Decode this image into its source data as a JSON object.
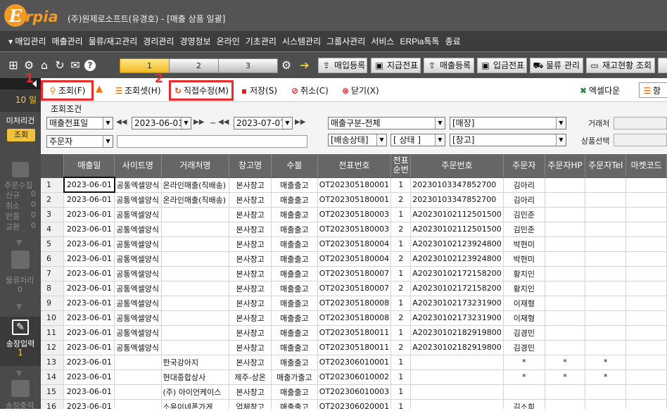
{
  "app": {
    "logo_initial": "E",
    "logo_rest": "rpia",
    "window_title": "(주)원제로소프트(유경호) - [매출 상품 일괄]"
  },
  "menu": [
    "▾ 매입관리",
    "매출관리",
    "물류/재고관리",
    "경리관리",
    "경영정보",
    "온라인",
    "기초관리",
    "시스템관리",
    "그룹사관리",
    "서비스",
    "ERPia톡톡",
    "종료"
  ],
  "tabs": [
    "1",
    "2",
    "3"
  ],
  "toolbar_buttons": [
    "매입등록",
    "지급전표",
    "매출등록",
    "입금전표",
    "물류 관리",
    "재고현황 조회"
  ],
  "left_panel": {
    "day": "10 일",
    "uncounted_label": "미처리건",
    "inquiry_btn": "조회",
    "order_collect": "주문수집",
    "new": "신규",
    "new_n": "0",
    "cancel": "취소",
    "cancel_n": "0",
    "return": "반품",
    "return_n": "0",
    "exchange": "교환",
    "exchange_n": "0",
    "logistics": "물류처리",
    "logistics_n": "0",
    "order_input": "송장입력",
    "order_input_n": "1",
    "ship_print": "송장출력"
  },
  "commands": {
    "search": "조회(F)",
    "search_set": "조회셋(H)",
    "direct_edit": "직접수정(M)",
    "save": "저장(S)",
    "cancel": "취소(C)",
    "close": "닫기(X)",
    "excel": "엑셀다운",
    "more": "항"
  },
  "annotations": {
    "label1": "1",
    "label2": "2"
  },
  "conditions": {
    "title": "조회조건",
    "date_type": "매출전표일",
    "date_from": "2023-06-01",
    "tilde": "~",
    "date_to": "2023-07-07",
    "sales_type": "매출구분-전체",
    "store": "[매장]",
    "customer_label": "거래처",
    "orderer": "주문자",
    "ship_status": "[배송상태]",
    "status": "[ 상태 ]",
    "warehouse": "[창고]",
    "product_label": "상품선택"
  },
  "grid": {
    "headers": [
      "매출일",
      "사이트명",
      "거래처명",
      "창고명",
      "수불",
      "전표번호",
      "전표\n순번",
      "주문번호",
      "주문자",
      "주문자HP",
      "주문자Tel",
      "마켓코드"
    ],
    "rows": [
      [
        "1",
        "2023-06-01",
        "공통엑셀양식",
        "온라인매출(직배송)",
        "본사창고",
        "매출출고",
        "OT202305180001",
        "1",
        "20230103347852700",
        "김아리",
        "",
        "",
        ""
      ],
      [
        "2",
        "2023-06-01",
        "공통엑셀양식",
        "온라인매출(직배송)",
        "본사창고",
        "매출출고",
        "OT202305180001",
        "2",
        "20230103347852700",
        "김아리",
        "",
        "",
        ""
      ],
      [
        "3",
        "2023-06-01",
        "공통엑셀양식",
        "",
        "본사창고",
        "매출출고",
        "OT202305180003",
        "1",
        "A20230102112501500",
        "김민준",
        "",
        "",
        ""
      ],
      [
        "4",
        "2023-06-01",
        "공통엑셀양식",
        "",
        "본사창고",
        "매출출고",
        "OT202305180003",
        "2",
        "A20230102112501500",
        "김민준",
        "",
        "",
        ""
      ],
      [
        "5",
        "2023-06-01",
        "공통엑셀양식",
        "",
        "본사창고",
        "매출출고",
        "OT202305180004",
        "1",
        "A20230102123924800",
        "박현미",
        "",
        "",
        ""
      ],
      [
        "6",
        "2023-06-01",
        "공통엑셀양식",
        "",
        "본사창고",
        "매출출고",
        "OT202305180004",
        "2",
        "A20230102123924800",
        "박현미",
        "",
        "",
        ""
      ],
      [
        "7",
        "2023-06-01",
        "공통엑셀양식",
        "",
        "본사창고",
        "매출출고",
        "OT202305180007",
        "1",
        "A20230102172158200",
        "황지인",
        "",
        "",
        ""
      ],
      [
        "8",
        "2023-06-01",
        "공통엑셀양식",
        "",
        "본사창고",
        "매출출고",
        "OT202305180007",
        "2",
        "A20230102172158200",
        "황지인",
        "",
        "",
        ""
      ],
      [
        "9",
        "2023-06-01",
        "공통엑셀양식",
        "",
        "본사창고",
        "매출출고",
        "OT202305180008",
        "1",
        "A20230102173231900",
        "이재형",
        "",
        "",
        ""
      ],
      [
        "10",
        "2023-06-01",
        "공통엑셀양식",
        "",
        "본사창고",
        "매출출고",
        "OT202305180008",
        "2",
        "A20230102173231900",
        "이재형",
        "",
        "",
        ""
      ],
      [
        "11",
        "2023-06-01",
        "공통엑셀양식",
        "",
        "본사창고",
        "매출출고",
        "OT202305180011",
        "1",
        "A20230102182919800",
        "김경민",
        "",
        "",
        ""
      ],
      [
        "12",
        "2023-06-01",
        "공통엑셀양식",
        "",
        "본사창고",
        "매출출고",
        "OT202305180011",
        "2",
        "A20230102182919800",
        "김경민",
        "",
        "",
        ""
      ],
      [
        "13",
        "2023-06-01",
        "",
        "한국강아지",
        "본사창고",
        "매출출고",
        "OT202306010001",
        "1",
        "",
        "*",
        "*",
        "*",
        ""
      ],
      [
        "14",
        "2023-06-01",
        "",
        "현대종합상사",
        "제주-상온",
        "매출가출고",
        "OT202306010002",
        "1",
        "",
        "*",
        "*",
        "*",
        ""
      ],
      [
        "15",
        "2023-06-01",
        "",
        "(주) 아이언케이스",
        "본사창고",
        "매출출고",
        "OT202306010003",
        "1",
        "",
        "",
        "",
        "",
        ""
      ],
      [
        "16",
        "2023-06-01",
        "",
        "소윤이네폰가게",
        "업체창고",
        "매출출고",
        "OT202306020001",
        "1",
        "",
        "김소희",
        "",
        "",
        ""
      ]
    ]
  }
}
